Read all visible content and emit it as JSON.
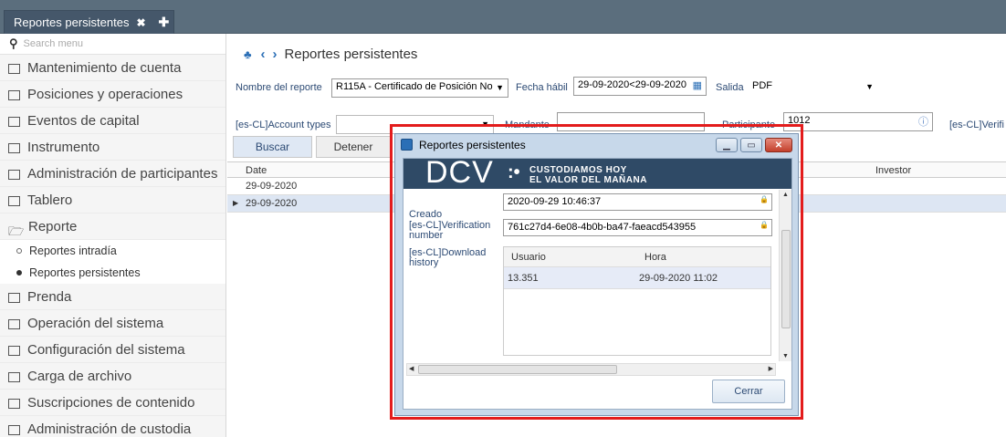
{
  "tab": {
    "label": "Reportes persistentes",
    "close": "✖",
    "add": "✚"
  },
  "sidebar": {
    "search_placeholder": "Search menu",
    "items": [
      {
        "label": "Mantenimiento de cuenta"
      },
      {
        "label": "Posiciones y operaciones"
      },
      {
        "label": "Eventos de capital"
      },
      {
        "label": "Instrumento"
      },
      {
        "label": "Administración de participantes"
      },
      {
        "label": "Tablero"
      },
      {
        "label": "Reporte"
      },
      {
        "label": "Prenda"
      },
      {
        "label": "Operación del sistema"
      },
      {
        "label": "Configuración del sistema"
      },
      {
        "label": "Carga de archivo"
      },
      {
        "label": "Suscripciones de contenido"
      },
      {
        "label": "Administración de custodia"
      }
    ],
    "subitems": [
      {
        "label": "Reportes intradía"
      },
      {
        "label": "Reportes persistentes"
      }
    ]
  },
  "main": {
    "title": "Reportes persistentes",
    "filters": {
      "report_name_label": "Nombre del reporte",
      "report_name_value": "R115A - Certificado de Posición No",
      "date_label": "Fecha hábil",
      "date_value": "29-09-2020<29-09-2020",
      "output_label": "Salida",
      "output_value": "PDF",
      "account_types_label": "[es-CL]Account types",
      "mandante_label": "Mandante",
      "participante_label": "Participante",
      "participante_value": "1012",
      "verif_label": "[es-CL]Verifi"
    },
    "buttons": {
      "search": "Buscar",
      "stop": "Detener"
    },
    "grid": {
      "columns": [
        "Date",
        "Investor"
      ],
      "rows": [
        {
          "date": "29-09-2020"
        },
        {
          "date": "29-09-2020"
        }
      ]
    }
  },
  "dialog": {
    "title": "Reportes persistentes",
    "banner": {
      "brand": "DCV",
      "dots": ":•",
      "line1": "CUSTODIAMOS HOY",
      "line2": "EL VALOR DEL MAÑANA"
    },
    "created_label": "Creado",
    "created_value": "2020-09-29 10:46:37",
    "verification_label_1": "[es-CL]Verification",
    "verification_label_2": "number",
    "verification_value": "761c27d4-6e08-4b0b-ba47-faeacd543955",
    "download_label_1": "[es-CL]Download",
    "download_label_2": "history",
    "history": {
      "columns": [
        "Usuario",
        "Hora"
      ],
      "rows": [
        {
          "user": "13.351",
          "time": "29-09-2020 11:02"
        }
      ]
    },
    "close_button": "Cerrar"
  },
  "colors": {
    "accent": "#2b6fb6",
    "highlight_border": "#e31c1c",
    "topbar": "#5b6e7d"
  }
}
